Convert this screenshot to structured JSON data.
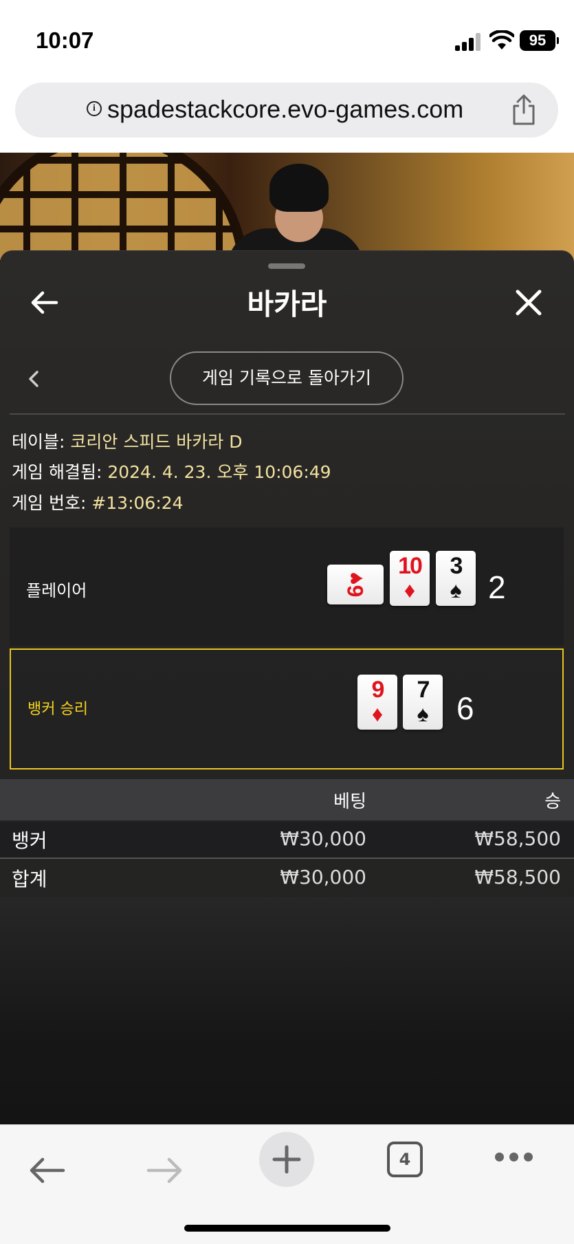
{
  "status_bar": {
    "time": "10:07",
    "battery": "95"
  },
  "browser": {
    "url": "spadestackcore.evo-games.com",
    "tab_count": "4"
  },
  "panel": {
    "title": "바카라",
    "history_button": "게임 기록으로 돌아가기",
    "table_label": "테이블:",
    "table_value": "코리안 스피드 바카라 D",
    "resolved_label": "게임 해결됨:",
    "resolved_value": "2024. 4. 23. 오후 10:06:49",
    "game_no_label": "게임 번호:",
    "game_no_value": "#13:06:24"
  },
  "results": {
    "player": {
      "label": "플레이어",
      "score": "2",
      "cards": [
        {
          "rank": "6",
          "suit": "♥",
          "color": "red",
          "sideways": true
        },
        {
          "rank": "10",
          "suit": "♦",
          "color": "red"
        },
        {
          "rank": "3",
          "suit": "♠",
          "color": "black"
        }
      ]
    },
    "banker": {
      "label": "뱅커 승리",
      "score": "6",
      "cards": [
        {
          "rank": "9",
          "suit": "♦",
          "color": "red"
        },
        {
          "rank": "7",
          "suit": "♠",
          "color": "black"
        }
      ]
    }
  },
  "bets": {
    "header_bet": "베팅",
    "header_win": "승",
    "rows": [
      {
        "name": "뱅커",
        "bet": "₩30,000",
        "win": "₩58,500"
      },
      {
        "name": "합계",
        "bet": "₩30,000",
        "win": "₩58,500"
      }
    ]
  },
  "colors": {
    "accent_yellow": "#e8c620",
    "value_text": "#f3e3a0",
    "card_red": "#e0141e"
  }
}
